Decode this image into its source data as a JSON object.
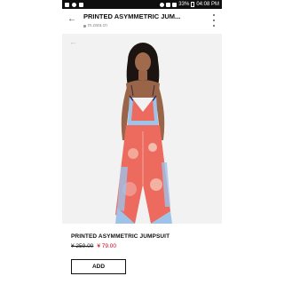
{
  "status_bar": {
    "battery_percent": "33%",
    "time": "04:08 PM",
    "left_icons": [
      "notification-icon",
      "cloud-icon",
      "download-icon"
    ],
    "right_icons": [
      "alarm-icon",
      "wifi-icon",
      "signal-icon",
      "battery-icon"
    ]
  },
  "header": {
    "title": "PRINTED ASYMMETRIC JUM...",
    "url": "m.zara.cn"
  },
  "product": {
    "name": "PRINTED ASYMMETRIC JUMPSUIT",
    "old_price": "¥ 259.00",
    "new_price": "¥ 79.00",
    "add_label": "ADD"
  },
  "colors": {
    "status_bar": "#0f0f0f",
    "sale_price": "#d0021b",
    "jumpsuit_primary": "#ec6a5e",
    "jumpsuit_secondary": "#9fc3e8"
  }
}
